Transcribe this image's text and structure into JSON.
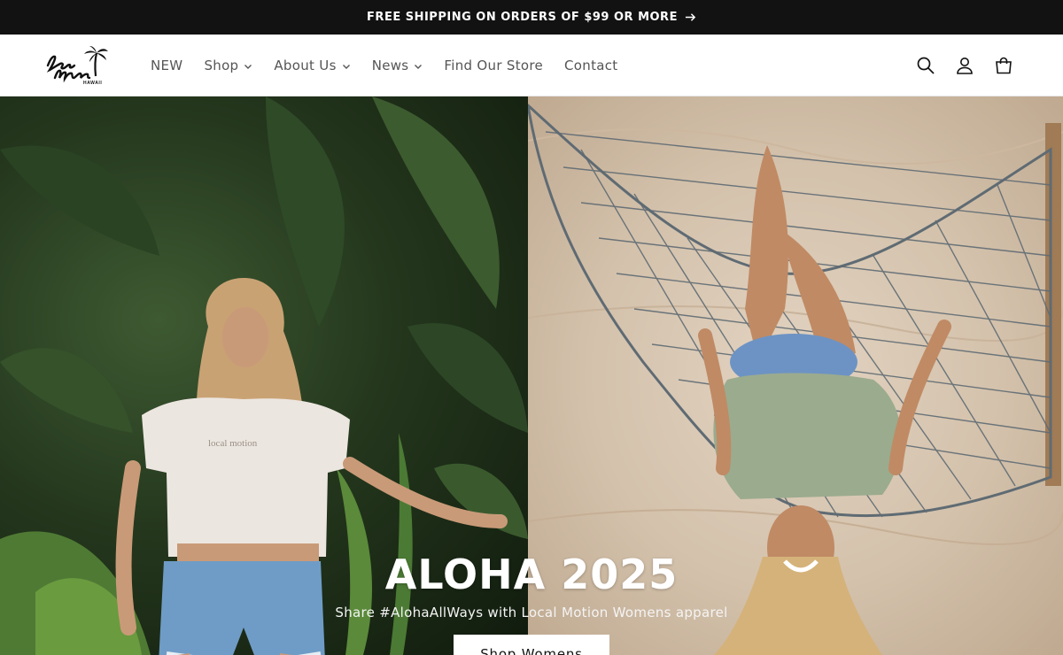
{
  "announcement": {
    "text": "FREE SHIPPING ON ORDERS OF $99 OR MORE",
    "arrow_icon": "arrow-right-icon"
  },
  "header": {
    "logo_alt": "Local Motion Hawaii",
    "nav": [
      {
        "label": "NEW",
        "has_dropdown": false
      },
      {
        "label": "Shop",
        "has_dropdown": true
      },
      {
        "label": "About Us",
        "has_dropdown": true
      },
      {
        "label": "News",
        "has_dropdown": true
      },
      {
        "label": "Find Our Store",
        "has_dropdown": false
      },
      {
        "label": "Contact",
        "has_dropdown": false
      }
    ],
    "icons": [
      "search-icon",
      "account-icon",
      "cart-icon"
    ]
  },
  "hero": {
    "title": "ALOHA 2025",
    "subtitle": "Share #AlohaAllWays with Local Motion Womens apparel",
    "button_label": "Shop Womens"
  },
  "colors": {
    "announcement_bg": "#121212",
    "nav_text": "#555555",
    "hero_text": "#ffffff"
  }
}
